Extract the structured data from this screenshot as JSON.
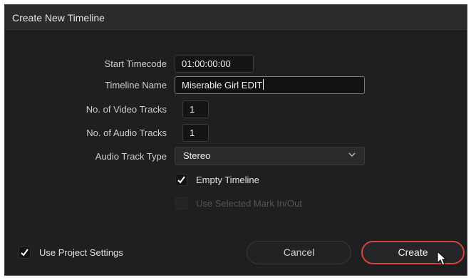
{
  "dialog": {
    "title": "Create New Timeline"
  },
  "form": {
    "start_timecode_label": "Start Timecode",
    "start_timecode_value": "01:00:00:00",
    "timeline_name_label": "Timeline Name",
    "timeline_name_value": "Miserable Girl EDIT",
    "video_tracks_label": "No. of Video Tracks",
    "video_tracks_value": "1",
    "audio_tracks_label": "No. of Audio Tracks",
    "audio_tracks_value": "1",
    "audio_track_type_label": "Audio Track Type",
    "audio_track_type_value": "Stereo",
    "empty_timeline_label": "Empty Timeline",
    "empty_timeline_checked": true,
    "use_mark_label": "Use Selected Mark In/Out",
    "use_mark_checked": false,
    "use_mark_disabled": true
  },
  "footer": {
    "use_project_settings_label": "Use Project Settings",
    "use_project_settings_checked": true,
    "cancel_label": "Cancel",
    "create_label": "Create"
  },
  "colors": {
    "accent": "#d9433c",
    "panel": "#1f1f21",
    "titlebar": "#2b2b2e"
  }
}
